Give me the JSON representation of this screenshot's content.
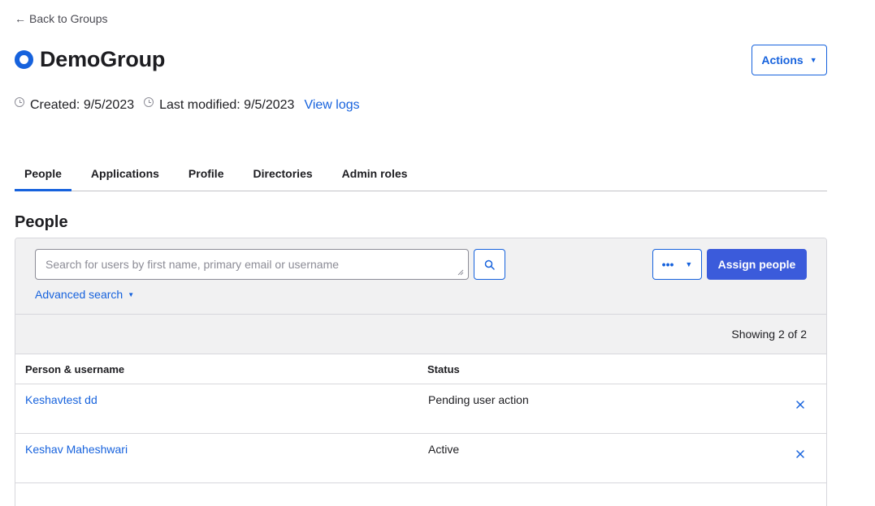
{
  "nav": {
    "back_label": "Back to Groups"
  },
  "group": {
    "name": "DemoGroup",
    "created_label": "Created:",
    "created_date": "9/5/2023",
    "modified_label": "Last modified:",
    "modified_date": "9/5/2023",
    "view_logs_label": "View logs"
  },
  "header": {
    "actions_label": "Actions"
  },
  "tabs": [
    {
      "label": "People",
      "active": true
    },
    {
      "label": "Applications",
      "active": false
    },
    {
      "label": "Profile",
      "active": false
    },
    {
      "label": "Directories",
      "active": false
    },
    {
      "label": "Admin roles",
      "active": false
    }
  ],
  "people": {
    "section_title": "People",
    "search_placeholder": "Search for users by first name, primary email or username",
    "search_value": "",
    "advanced_search_label": "Advanced search",
    "more_label": "•••",
    "assign_label": "Assign people",
    "showing_text": "Showing 2 of 2",
    "columns": {
      "person": "Person & username",
      "status": "Status"
    },
    "rows": [
      {
        "person": "Keshavtest dd",
        "status": "Pending user action"
      },
      {
        "person": "Keshav Maheshwari",
        "status": "Active"
      }
    ]
  },
  "colors": {
    "accent": "#1662dd",
    "primary_button": "#3b5bdb",
    "toolbar_bg": "#f1f1f2"
  },
  "icons": [
    "arrow-left-icon",
    "group-ring-icon",
    "clock-icon",
    "search-icon",
    "caret-down-icon",
    "close-icon"
  ]
}
